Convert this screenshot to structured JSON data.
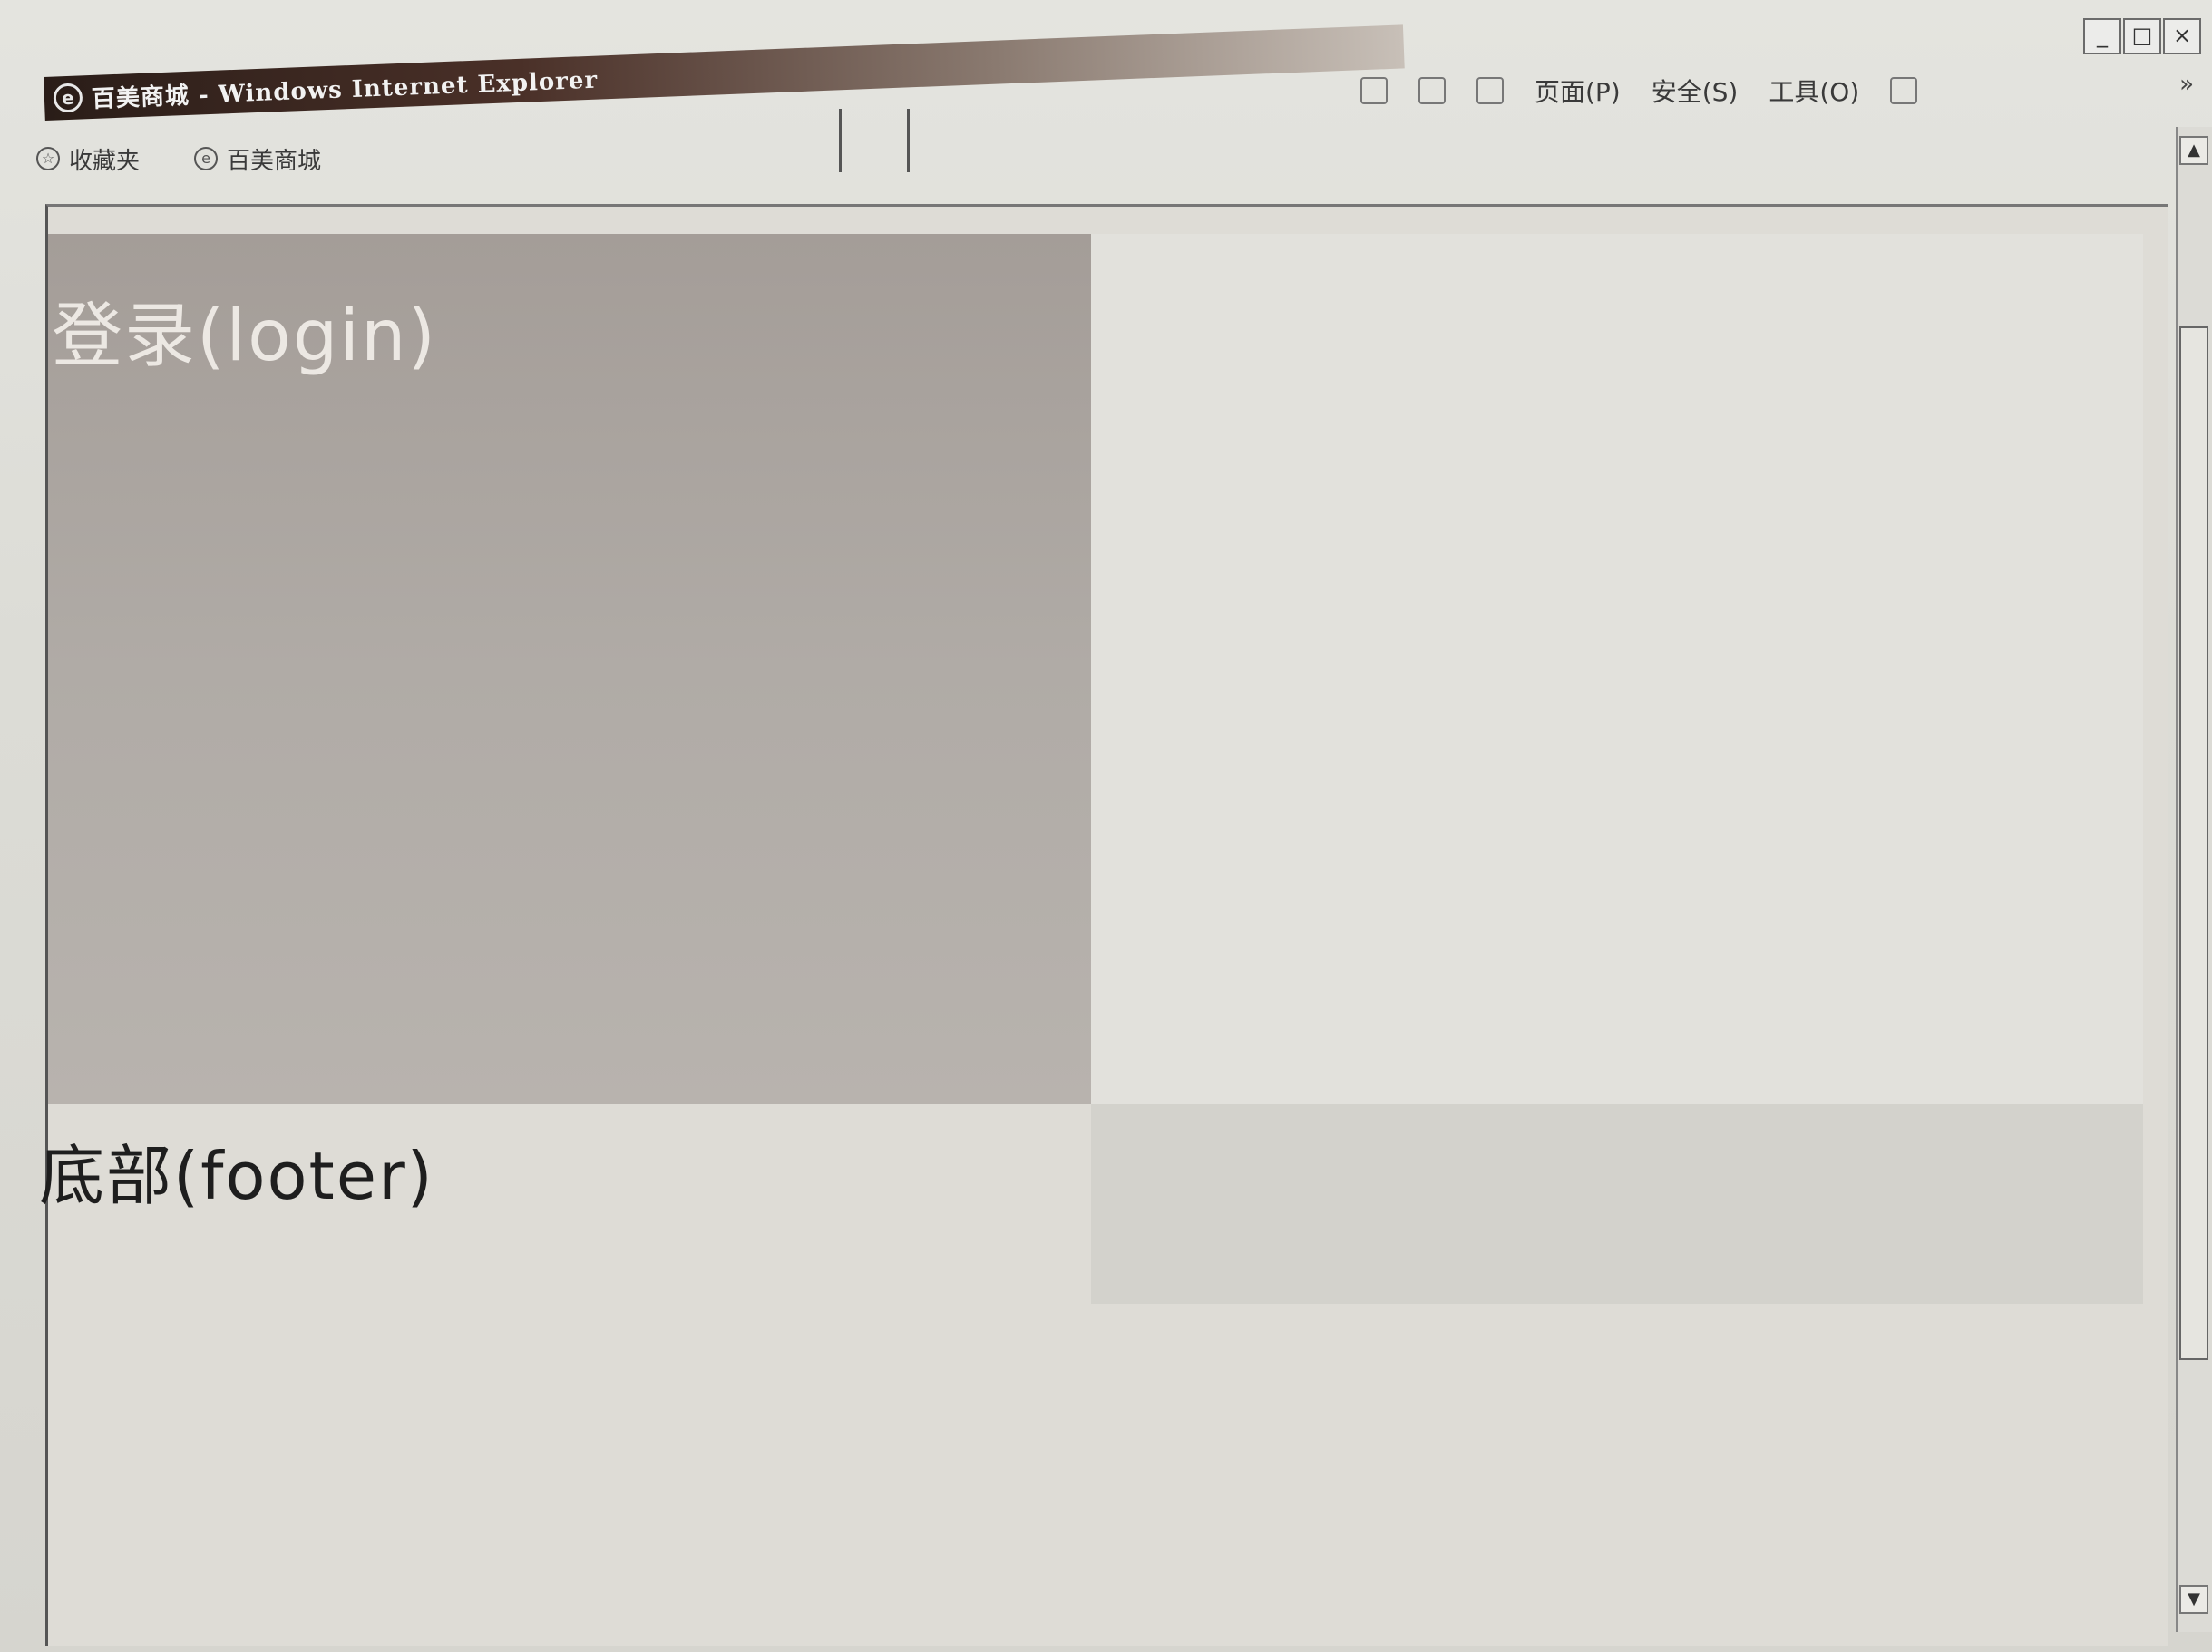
{
  "window": {
    "title": "百美商城 - Windows Internet Explorer",
    "controls": {
      "minimize": "_",
      "maximize": "□",
      "close": "×"
    }
  },
  "favorites_bar": {
    "items": [
      {
        "label": "收藏夹",
        "icon": "star-icon"
      },
      {
        "label": "百美商城",
        "icon": "ie-page-icon"
      }
    ]
  },
  "command_bar": {
    "items": [
      {
        "label": "页面(P)",
        "icon": "page-icon"
      },
      {
        "label": "安全(S)",
        "icon": "security-icon"
      },
      {
        "label": "工具(O)",
        "icon": "tools-icon"
      }
    ],
    "overflow": "»"
  },
  "page": {
    "login_heading": "登录(login)",
    "footer_heading": "底部(footer)"
  },
  "scrollbar": {
    "up": "▲",
    "down": "▼"
  }
}
